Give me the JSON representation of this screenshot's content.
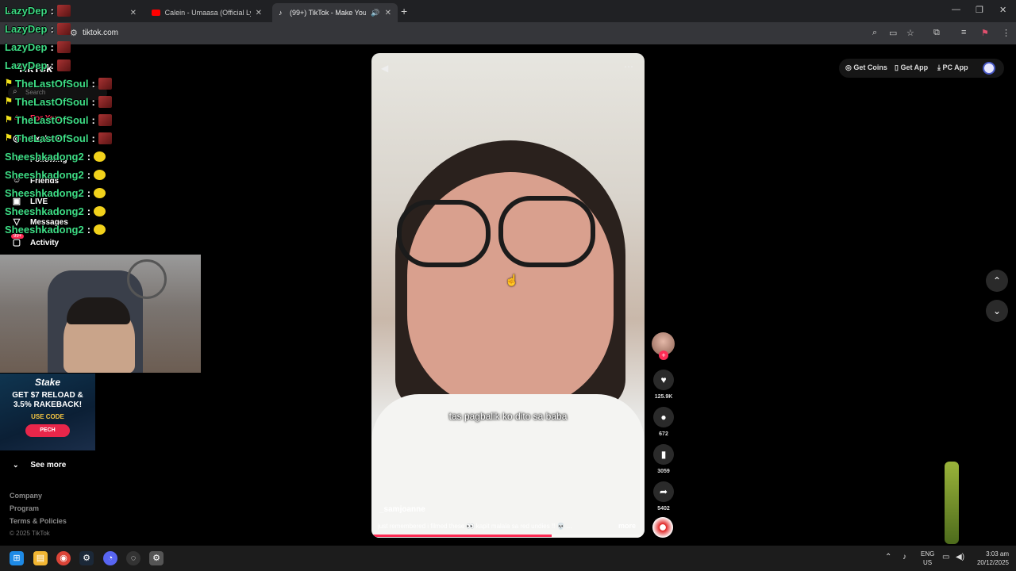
{
  "browser": {
    "tabs": [
      {
        "label": "",
        "icon": "tiktok-icon"
      },
      {
        "label": "Calein - Umaasa (Official Lyric V",
        "icon": "youtube-icon"
      },
      {
        "label": "(99+) TikTok - Make Your Da",
        "icon": "tiktok-icon"
      }
    ],
    "url": "tiktok.com"
  },
  "sidebar": {
    "logo": "TikTok",
    "search_placeholder": "Search",
    "items": [
      {
        "label": "For You",
        "icon": "home-icon"
      },
      {
        "label": "Explore",
        "icon": "compass-icon"
      },
      {
        "label": "Following",
        "icon": "following-icon"
      },
      {
        "label": "Friends",
        "icon": "friends-icon"
      },
      {
        "label": "LIVE",
        "icon": "live-icon"
      },
      {
        "label": "Messages",
        "icon": "messages-icon"
      },
      {
        "label": "Activity",
        "icon": "activity-icon"
      }
    ],
    "activity_badge": "99+",
    "see_more": "See more",
    "footer": [
      "Company",
      "Program",
      "Terms & Policies"
    ],
    "copyright": "© 2025 TikTok"
  },
  "chat": [
    {
      "user": "LazyDep",
      "emote": "red"
    },
    {
      "user": "LazyDep",
      "emote": "red"
    },
    {
      "user": "LazyDep",
      "emote": "red"
    },
    {
      "user": "LazyDep",
      "emote": "red"
    },
    {
      "user": "TheLastOfSoul",
      "emote": "red",
      "flag": true
    },
    {
      "user": "TheLastOfSoul",
      "emote": "red",
      "flag": true
    },
    {
      "user": "TheLastOfSoul",
      "emote": "red",
      "flag": true
    },
    {
      "user": "TheLastOfSoul",
      "emote": "red",
      "flag": true
    },
    {
      "user": "Sheeshkadong2",
      "emote": "yellow"
    },
    {
      "user": "Sheeshkadong2",
      "emote": "yellow"
    },
    {
      "user": "Sheeshkadong2",
      "emote": "yellow"
    },
    {
      "user": "Sheeshkadong2",
      "emote": "yellow"
    },
    {
      "user": "Sheeshkadong2",
      "emote": "yellow"
    }
  ],
  "ad": {
    "brand": "Stake",
    "line1": "GET $7 RELOAD &",
    "line2": "3.5% RAKEBACK!",
    "code_label": "USE CODE",
    "code": "PECH"
  },
  "video": {
    "caption": "tas pagbalik ko dito sa baba",
    "username": "_samjoanne",
    "description": "just remembered i filmed these 👀 kapit malala sa red undies !! 💀 ...",
    "more_label": "more",
    "progress": 0.66
  },
  "actions": {
    "likes": "125.9K",
    "comments": "672",
    "saves": "3059",
    "shares": "5402"
  },
  "top_right": {
    "get_coins": "Get Coins",
    "get_app": "Get App",
    "pc_app": "PC App"
  },
  "taskbar": {
    "lang1": "ENG",
    "lang2": "US",
    "time": "3:03 am",
    "date": "20/12/2025"
  },
  "colors": {
    "accent": "#fe2c55",
    "chat_name": "#3ddc84"
  }
}
